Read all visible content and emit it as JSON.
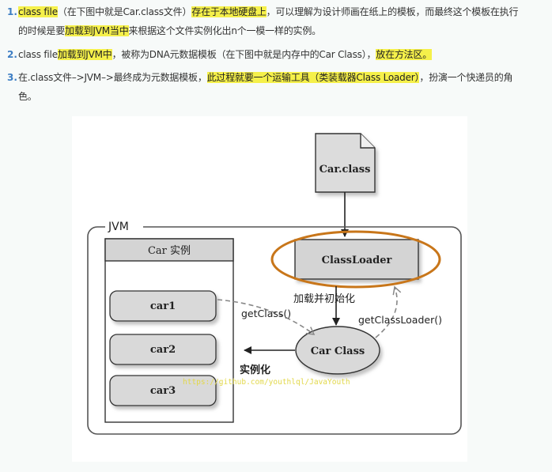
{
  "list": {
    "items": [
      {
        "number": "1.",
        "line1": [
          {
            "t": "class file",
            "hl": true
          },
          {
            "t": "（在下图中就是Car.class文件）",
            "hl": false
          },
          {
            "t": "存在于本地硬盘上",
            "hl": true
          },
          {
            "t": "，可以理解为设计师画在纸上的模板，而最终这个模板在执行",
            "hl": false
          }
        ],
        "line2": [
          {
            "t": "的时候是要",
            "hl": false
          },
          {
            "t": "加载到JVM当中",
            "hl": true
          },
          {
            "t": "来根据这个文件实例化出n个一模一样的实例。",
            "hl": false
          }
        ]
      },
      {
        "number": "2.",
        "line1": [
          {
            "t": "class file",
            "hl": false
          },
          {
            "t": "加载到JVM中",
            "hl": true
          },
          {
            "t": "，被称为DNA元数据模板（在下图中就是内存中的Car Class），",
            "hl": false
          },
          {
            "t": "放在方法区。",
            "hl": true
          }
        ]
      },
      {
        "number": "3.",
        "line1": [
          {
            "t": "在.class文件–>JVM–>最终成为元数据模板，",
            "hl": false
          },
          {
            "t": "此过程就要一个运输工具（类装载器Class Loader）",
            "hl": true
          },
          {
            "t": "，扮演一个快递员的角",
            "hl": false
          }
        ],
        "line2": [
          {
            "t": "色。",
            "hl": false
          }
        ]
      }
    ]
  },
  "diagram": {
    "file_label": "Car.class",
    "jvm_label": "JVM",
    "instance_panel_title": "Car 实例",
    "instances": [
      "car1",
      "car2",
      "car3"
    ],
    "classloader_label": "ClassLoader",
    "carclass_label": "Car Class",
    "load_init_label": "加载并初始化",
    "getclass_label": "getClass()",
    "getclassloader_label": "getClassLoader()",
    "instantiate_label": "实例化",
    "watermark": "https://github.com/youthlql/JavaYouth",
    "colors": {
      "highlight": "#f5f04a",
      "number": "#3d7ec4",
      "gray_box": "#d9d9d9",
      "orange_ring": "#c8761a"
    }
  }
}
